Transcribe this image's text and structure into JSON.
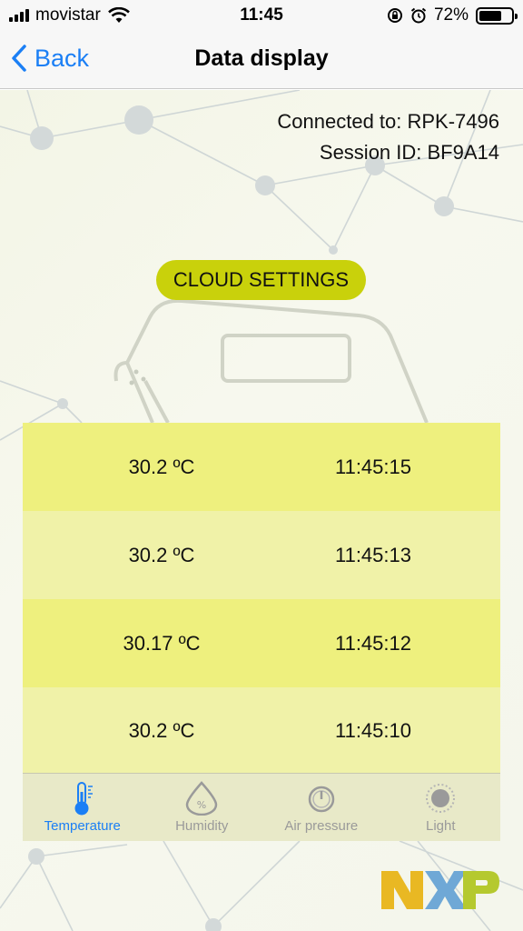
{
  "status": {
    "carrier": "movistar",
    "time": "11:45",
    "battery_pct": "72%",
    "battery_level": 0.72
  },
  "nav": {
    "back_label": "Back",
    "title": "Data display"
  },
  "connection": {
    "connected_text": "Connected to: RPK-7496",
    "session_text": "Session ID: BF9A14"
  },
  "cloud_button": "CLOUD SETTINGS",
  "readings": [
    {
      "value": "30.2 ºC",
      "time": "11:45:15"
    },
    {
      "value": "30.2 ºC",
      "time": "11:45:13"
    },
    {
      "value": "30.17 ºC",
      "time": "11:45:12"
    },
    {
      "value": "30.2 ºC",
      "time": "11:45:10"
    }
  ],
  "tabs": [
    {
      "label": "Temperature",
      "icon": "thermometer-icon",
      "active": true
    },
    {
      "label": "Humidity",
      "icon": "humidity-drop-icon",
      "active": false
    },
    {
      "label": "Air pressure",
      "icon": "gauge-icon",
      "active": false
    },
    {
      "label": "Light",
      "icon": "sun-icon",
      "active": false
    }
  ],
  "logo_text": "NXP",
  "colors": {
    "accent": "#1b7ff5",
    "button": "#c9d10b",
    "row_dark": "#eef07e",
    "row_light": "#f0f2a8"
  }
}
